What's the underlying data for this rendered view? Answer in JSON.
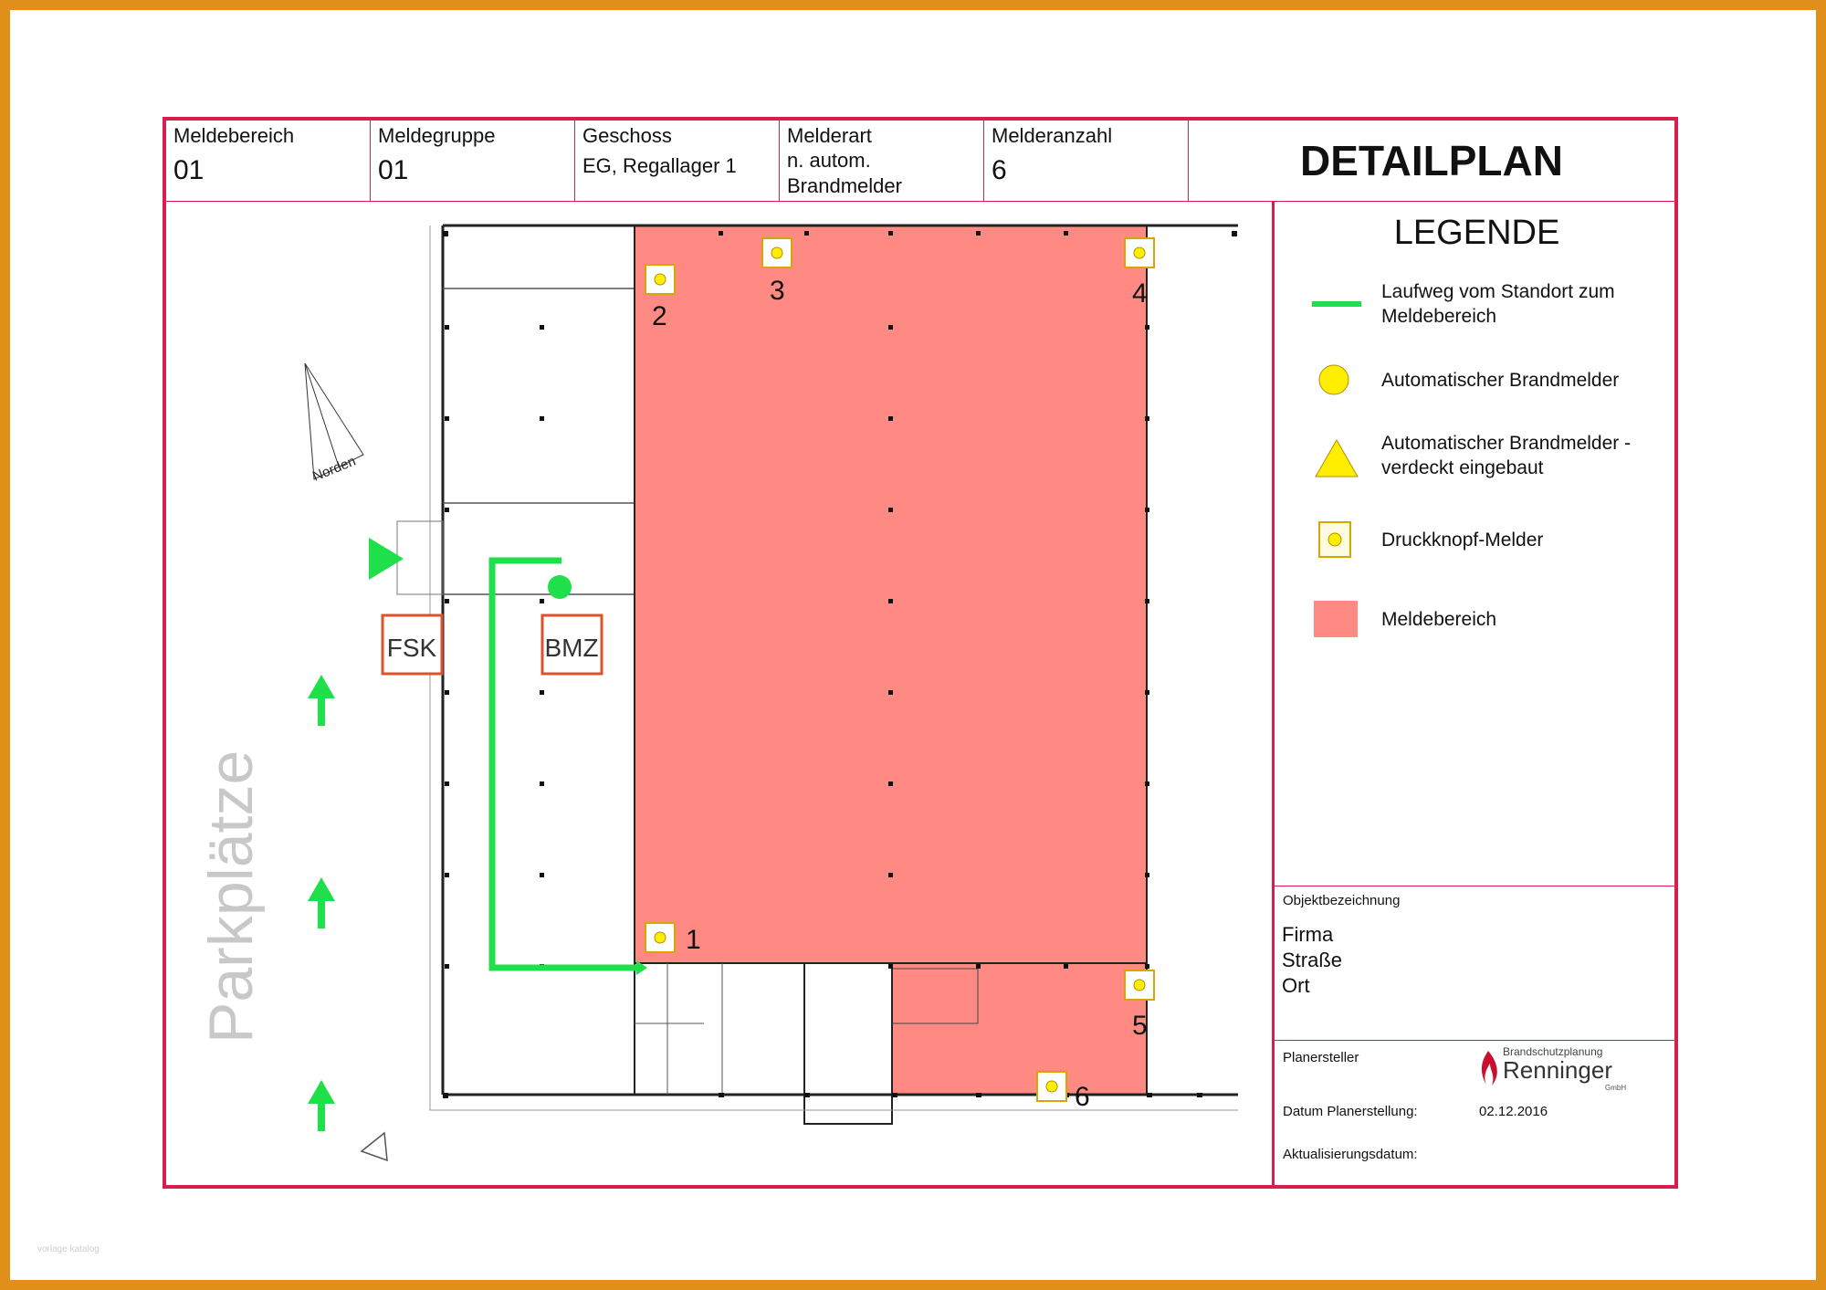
{
  "header": {
    "meldebereich": {
      "label": "Meldebereich",
      "value": "01"
    },
    "meldegruppe": {
      "label": "Meldegruppe",
      "value": "01"
    },
    "geschoss": {
      "label": "Geschoss",
      "value": "EG, Regallager 1"
    },
    "melderart": {
      "label": "Melderart",
      "value_line1": "n. autom.",
      "value_line2": "Brandmelder"
    },
    "melderanzahl": {
      "label": "Melderanzahl",
      "value": "6"
    },
    "title": "DETAILPLAN"
  },
  "legend": {
    "title": "LEGENDE",
    "items": [
      {
        "line1": "Laufweg vom Standort zum",
        "line2": "Meldebereich",
        "symbol": "green-line"
      },
      {
        "line1": "Automatischer Brandmelder",
        "line2": "",
        "symbol": "yellow-circle"
      },
      {
        "line1": "Automatischer Brandmelder -",
        "line2": "verdeckt eingebaut",
        "symbol": "yellow-triangle"
      },
      {
        "line1": "Druckknopf-Melder",
        "line2": "",
        "symbol": "push-button"
      },
      {
        "line1": "Meldebereich",
        "line2": "",
        "symbol": "salmon-square"
      }
    ]
  },
  "object": {
    "label": "Objektbezeichnung",
    "line1": "Firma",
    "line2": "Straße",
    "line3": "Ort"
  },
  "planner": {
    "label": "Planersteller",
    "logo_line1": "Brandschutzplanung",
    "logo_line2": "Renninger",
    "logo_line3": "GmbH",
    "date_label": "Datum Planerstellung:",
    "date_value": "02.12.2016",
    "update_label": "Aktualisierungsdatum:",
    "update_value": ""
  },
  "plan": {
    "north_label": "Norden",
    "parking_label": "Parkplätze",
    "fsk_label": "FSK",
    "bmz_label": "BMZ",
    "detectors": [
      "1",
      "2",
      "3",
      "4",
      "5",
      "6"
    ]
  },
  "colors": {
    "frame": "#d6204b",
    "zone": "#ff8a84",
    "route": "#1fe04a",
    "detector": "#ffee00",
    "box": "#d9542a",
    "border": "#e08f1a"
  },
  "watermark": "vorlage katalog"
}
